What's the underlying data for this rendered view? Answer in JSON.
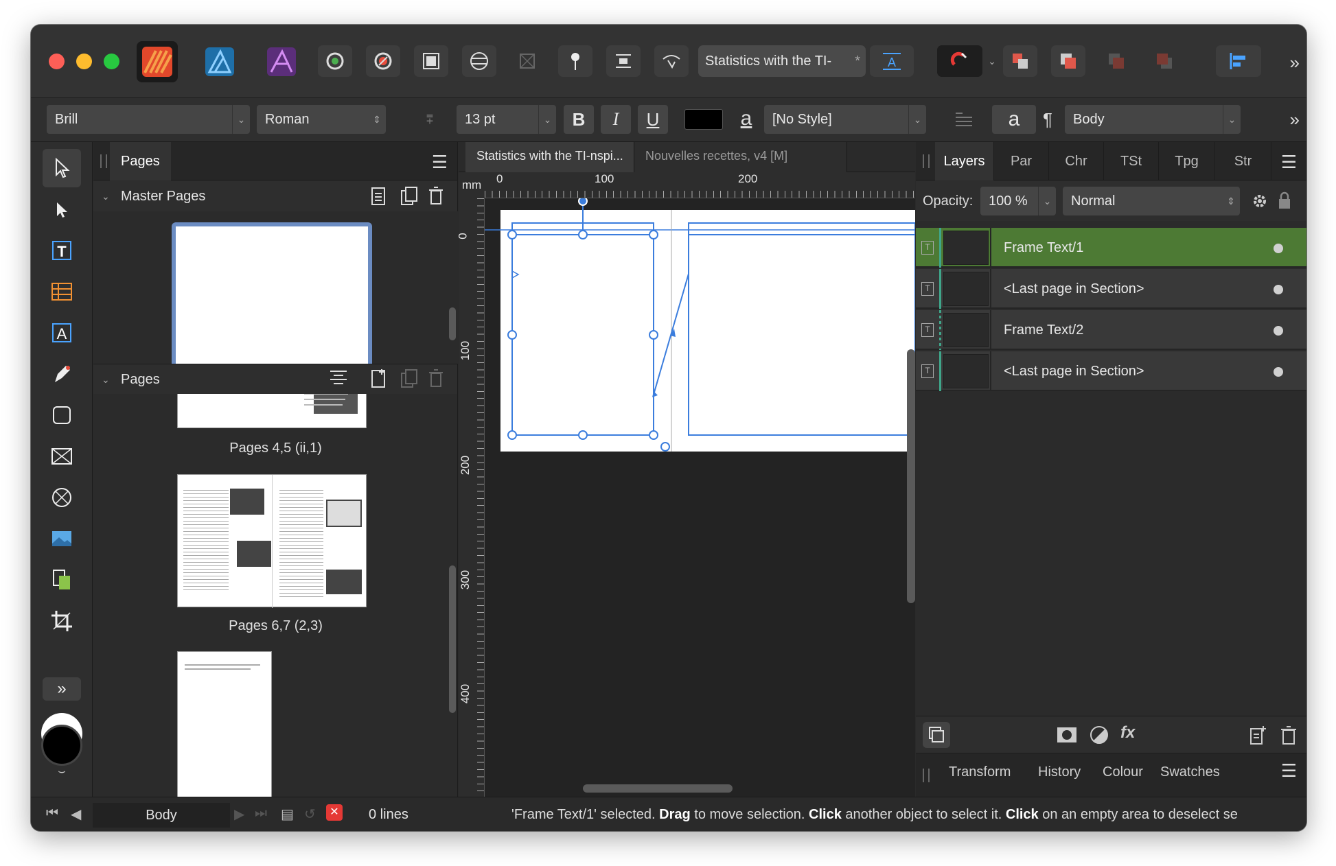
{
  "titlebar": {
    "document_field": "Statistics with the TI-",
    "document_field_star": "*"
  },
  "context_bar": {
    "font_family": "Brill",
    "font_style": "Roman",
    "font_size": "13 pt",
    "bold": "B",
    "italic": "I",
    "underline": "U",
    "char_style_glyph": "a",
    "char_style": "[No Style]",
    "para_glyph": "a",
    "para_mark": "¶",
    "para_style": "Body",
    "color_swatch": "#000000"
  },
  "pages_panel": {
    "tab": "Pages",
    "master_section": "Master Pages",
    "pages_section": "Pages",
    "thumbs": [
      {
        "label": "Pages 4,5 (ii,1)"
      },
      {
        "label": "Pages 6,7 (2,3)"
      }
    ]
  },
  "canvas": {
    "tabs": [
      {
        "label": "Statistics with the TI-nspi..."
      },
      {
        "label": "Nouvelles recettes, v4 [M]"
      }
    ],
    "ruler_unit": "mm",
    "ruler_h_labels": [
      "0",
      "100",
      "200"
    ],
    "ruler_v_labels": [
      "0",
      "100",
      "200",
      "300",
      "400"
    ]
  },
  "layers_panel": {
    "tabs": [
      "Layers",
      "Par",
      "Chr",
      "TSt",
      "Tpg",
      "Str"
    ],
    "opacity_label": "Opacity:",
    "opacity_value": "100 %",
    "blend_mode": "Normal",
    "layers": [
      {
        "name": "Frame Text/1",
        "selected": true
      },
      {
        "name": "<Last page in Section>",
        "selected": false
      },
      {
        "name": "Frame Text/2",
        "selected": false
      },
      {
        "name": "<Last page in Section>",
        "selected": false
      }
    ],
    "bottom_tabs": [
      "Transform",
      "History",
      "Colour",
      "Swatches"
    ]
  },
  "statusbar": {
    "style": "Body",
    "lines": "0 lines",
    "message_pre": "'Frame Text/1' selected. ",
    "drag": "Drag",
    "msg_1": " to move selection. ",
    "click1": "Click",
    "msg_2": " another object to select it. ",
    "click2": "Click",
    "msg_3": " on an empty area to deselect se"
  },
  "colors": {
    "selection_blue": "#3b7ddd",
    "layer_selected": "#4d7a34",
    "window_bg": "#2a2a2a"
  }
}
